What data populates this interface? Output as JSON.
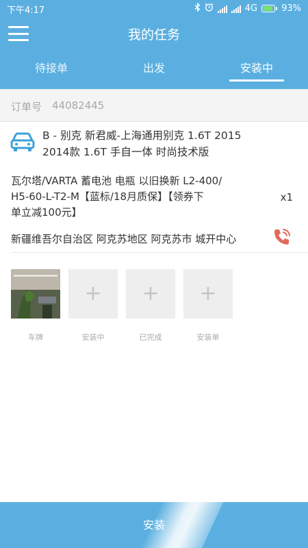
{
  "status_bar": {
    "time": "下午4:17",
    "network": "4G",
    "battery": "93%"
  },
  "header": {
    "title": "我的任务",
    "tabs": [
      {
        "label": "待接单"
      },
      {
        "label": "出发"
      },
      {
        "label": "安装中"
      }
    ],
    "active_tab": "安装中"
  },
  "order": {
    "label": "订单号",
    "number": "44082445"
  },
  "car": {
    "line1": "B - 别克 新君威-上海通用别克 1.6T 2015",
    "line2": "2014款 1.6T 手自一体 时尚技术版"
  },
  "product": {
    "line1": "瓦尔塔/VARTA 蓄电池 电瓶 以旧换新 L2-400/",
    "line2": "H5-60-L-T2-M【蓝标/18月质保】【领券下",
    "line3": "单立减100元】",
    "quantity": "x1"
  },
  "address": "新疆维吾尔自治区 阿克苏地区 阿克苏市 城开中心",
  "photos": [
    {
      "label": "车牌"
    },
    {
      "label": "安装中"
    },
    {
      "label": "已完成"
    },
    {
      "label": "安装单"
    }
  ],
  "bottom_button": {
    "label": "安装"
  },
  "colors": {
    "primary": "#5aafe0",
    "car_icon": "#3ca0d8",
    "phone_icon": "#e06a5a"
  }
}
